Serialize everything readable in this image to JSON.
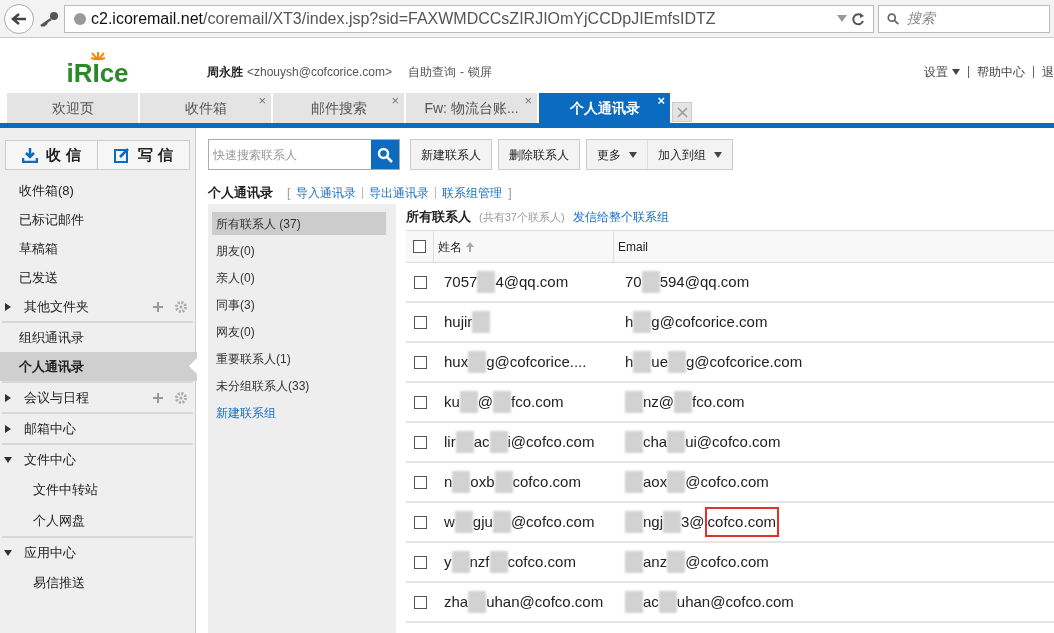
{
  "browser": {
    "url_host": "c2.icoremail.net",
    "url_path": "/coremail/XT3/index.jsp?sid=FAXWMDCCsZIRJIOmYjCCDpJIEmfsIDTZ",
    "search_placeholder": "搜索"
  },
  "header": {
    "logo": "iRIce",
    "user_name": "周永胜",
    "user_email": "<zhouysh@cofcorice.com>",
    "links": [
      "自助查询",
      "锁屏"
    ],
    "link_separator": "-",
    "right_links": [
      "设置",
      "帮助中心",
      "退"
    ]
  },
  "tabs": [
    {
      "label": "欢迎页",
      "selected": false
    },
    {
      "label": "收件箱",
      "selected": false,
      "close": "×"
    },
    {
      "label": "邮件搜索",
      "selected": false,
      "close": "×"
    },
    {
      "label": "Fw: 物流台账...",
      "selected": false,
      "close": "×"
    },
    {
      "label": "个人通讯录",
      "selected": true,
      "close": "×"
    }
  ],
  "sidebar": {
    "receive_button": "收 信",
    "write_button": "写 信",
    "items": [
      {
        "kind": "item",
        "label": "收件箱(8)",
        "selected": false
      },
      {
        "kind": "item",
        "label": "已标记邮件",
        "selected": false
      },
      {
        "kind": "item",
        "label": "草稿箱",
        "selected": false
      },
      {
        "kind": "item",
        "label": "已发送",
        "selected": false
      },
      {
        "kind": "folder",
        "label": "其他文件夹",
        "expanded": false,
        "tools": true,
        "divider": true
      },
      {
        "kind": "item",
        "label": "组织通讯录",
        "selected": false
      },
      {
        "kind": "item",
        "label": "个人通讯录",
        "selected": true,
        "divider": true
      },
      {
        "kind": "folder",
        "label": "会议与日程",
        "expanded": false,
        "tools": true,
        "divider": true
      },
      {
        "kind": "folder",
        "label": "邮箱中心",
        "expanded": false,
        "tools": false,
        "divider": true
      },
      {
        "kind": "folder",
        "label": "文件中心",
        "expanded": true,
        "tools": false,
        "children": [
          {
            "label": "文件中转站"
          },
          {
            "label": "个人网盘"
          }
        ],
        "divider": true
      },
      {
        "kind": "folder",
        "label": "应用中心",
        "expanded": true,
        "tools": false,
        "children": [
          {
            "label": "易信推送"
          }
        ]
      }
    ]
  },
  "toolbar": {
    "search_placeholder": "快速搜索联系人",
    "buttons": [
      {
        "label": "新建联系人",
        "dropdown": false
      },
      {
        "label": "删除联系人",
        "dropdown": false
      },
      {
        "label": "更多",
        "dropdown": true
      },
      {
        "label": "加入到组",
        "dropdown": true
      }
    ]
  },
  "section": {
    "title": "个人通讯录",
    "open_bracket": "[",
    "close_bracket": "]",
    "links": [
      "导入通讯录",
      "导出通讯录",
      "联系组管理"
    ]
  },
  "groups": [
    {
      "label": "所有联系人 (37)",
      "selected": true
    },
    {
      "label": "朋友(0)",
      "selected": false
    },
    {
      "label": "亲人(0)",
      "selected": false
    },
    {
      "label": "同事(3)",
      "selected": false
    },
    {
      "label": "网友(0)",
      "selected": false
    },
    {
      "label": "重要联系人(1)",
      "selected": false
    },
    {
      "label": "未分组联系人(33)",
      "selected": false
    },
    {
      "label": "新建联系组",
      "selected": false,
      "kind": "link"
    }
  ],
  "list": {
    "title": "所有联系人",
    "count": "(共有37个联系人)",
    "send_link": "发信给整个联系组",
    "columns": [
      "姓名",
      "Email"
    ],
    "all_checked": false,
    "rows": [
      {
        "checked": false,
        "name": [
          {
            "kind": "text",
            "text": "7057"
          },
          {
            "kind": "redaction"
          },
          {
            "kind": "text",
            "text": "4@qq.com"
          }
        ],
        "email": [
          {
            "kind": "text",
            "text": "70"
          },
          {
            "kind": "redaction"
          },
          {
            "kind": "text",
            "text": "594@qq.com"
          }
        ]
      },
      {
        "checked": false,
        "name": [
          {
            "kind": "text",
            "text": "hujir"
          },
          {
            "kind": "redaction"
          }
        ],
        "email": [
          {
            "kind": "text",
            "text": "h"
          },
          {
            "kind": "redaction"
          },
          {
            "kind": "text",
            "text": "g@cofcorice.com"
          }
        ]
      },
      {
        "checked": false,
        "name": [
          {
            "kind": "text",
            "text": "hux"
          },
          {
            "kind": "redaction"
          },
          {
            "kind": "text",
            "text": "g@cofcorice...."
          }
        ],
        "email": [
          {
            "kind": "text",
            "text": "h"
          },
          {
            "kind": "redaction"
          },
          {
            "kind": "text",
            "text": "ue"
          },
          {
            "kind": "redaction"
          },
          {
            "kind": "text",
            "text": "g@cofcorice.com"
          }
        ]
      },
      {
        "checked": false,
        "name": [
          {
            "kind": "text",
            "text": "ku"
          },
          {
            "kind": "redaction"
          },
          {
            "kind": "text",
            "text": "@"
          },
          {
            "kind": "redaction"
          },
          {
            "kind": "text",
            "text": "fco.com"
          }
        ],
        "email": [
          {
            "kind": "redaction"
          },
          {
            "kind": "text",
            "text": "nz@"
          },
          {
            "kind": "redaction"
          },
          {
            "kind": "text",
            "text": "fco.com"
          }
        ]
      },
      {
        "checked": false,
        "name": [
          {
            "kind": "text",
            "text": "lir"
          },
          {
            "kind": "redaction"
          },
          {
            "kind": "text",
            "text": "ac"
          },
          {
            "kind": "redaction"
          },
          {
            "kind": "text",
            "text": "i@cofco.com"
          }
        ],
        "email": [
          {
            "kind": "redaction"
          },
          {
            "kind": "text",
            "text": "cha"
          },
          {
            "kind": "redaction"
          },
          {
            "kind": "text",
            "text": "ui@cofco.com"
          }
        ]
      },
      {
        "checked": false,
        "name": [
          {
            "kind": "text",
            "text": "n"
          },
          {
            "kind": "redaction"
          },
          {
            "kind": "text",
            "text": "oxb"
          },
          {
            "kind": "redaction"
          },
          {
            "kind": "text",
            "text": "cofco.com"
          }
        ],
        "email": [
          {
            "kind": "redaction"
          },
          {
            "kind": "text",
            "text": "aox"
          },
          {
            "kind": "redaction"
          },
          {
            "kind": "text",
            "text": "@cofco.com"
          }
        ]
      },
      {
        "checked": false,
        "name": [
          {
            "kind": "text",
            "text": "w"
          },
          {
            "kind": "redaction"
          },
          {
            "kind": "text",
            "text": "gju"
          },
          {
            "kind": "redaction"
          },
          {
            "kind": "text",
            "text": "@cofco.com"
          }
        ],
        "email": [
          {
            "kind": "redaction"
          },
          {
            "kind": "text",
            "text": "ngj"
          },
          {
            "kind": "redaction"
          },
          {
            "kind": "text",
            "text": "3@"
          },
          {
            "kind": "highlight",
            "text": "cofco.com"
          }
        ]
      },
      {
        "checked": false,
        "name": [
          {
            "kind": "text",
            "text": "y"
          },
          {
            "kind": "redaction"
          },
          {
            "kind": "text",
            "text": "nzf"
          },
          {
            "kind": "redaction"
          },
          {
            "kind": "text",
            "text": "cofco.com"
          }
        ],
        "email": [
          {
            "kind": "redaction"
          },
          {
            "kind": "text",
            "text": "anz"
          },
          {
            "kind": "redaction"
          },
          {
            "kind": "text",
            "text": "@cofco.com"
          }
        ]
      },
      {
        "checked": false,
        "name": [
          {
            "kind": "text",
            "text": "zha"
          },
          {
            "kind": "redaction"
          },
          {
            "kind": "text",
            "text": "uhan@cofco.com"
          }
        ],
        "email": [
          {
            "kind": "redaction"
          },
          {
            "kind": "text",
            "text": "ac"
          },
          {
            "kind": "redaction"
          },
          {
            "kind": "text",
            "text": "uhan@cofco.com"
          }
        ]
      }
    ]
  }
}
